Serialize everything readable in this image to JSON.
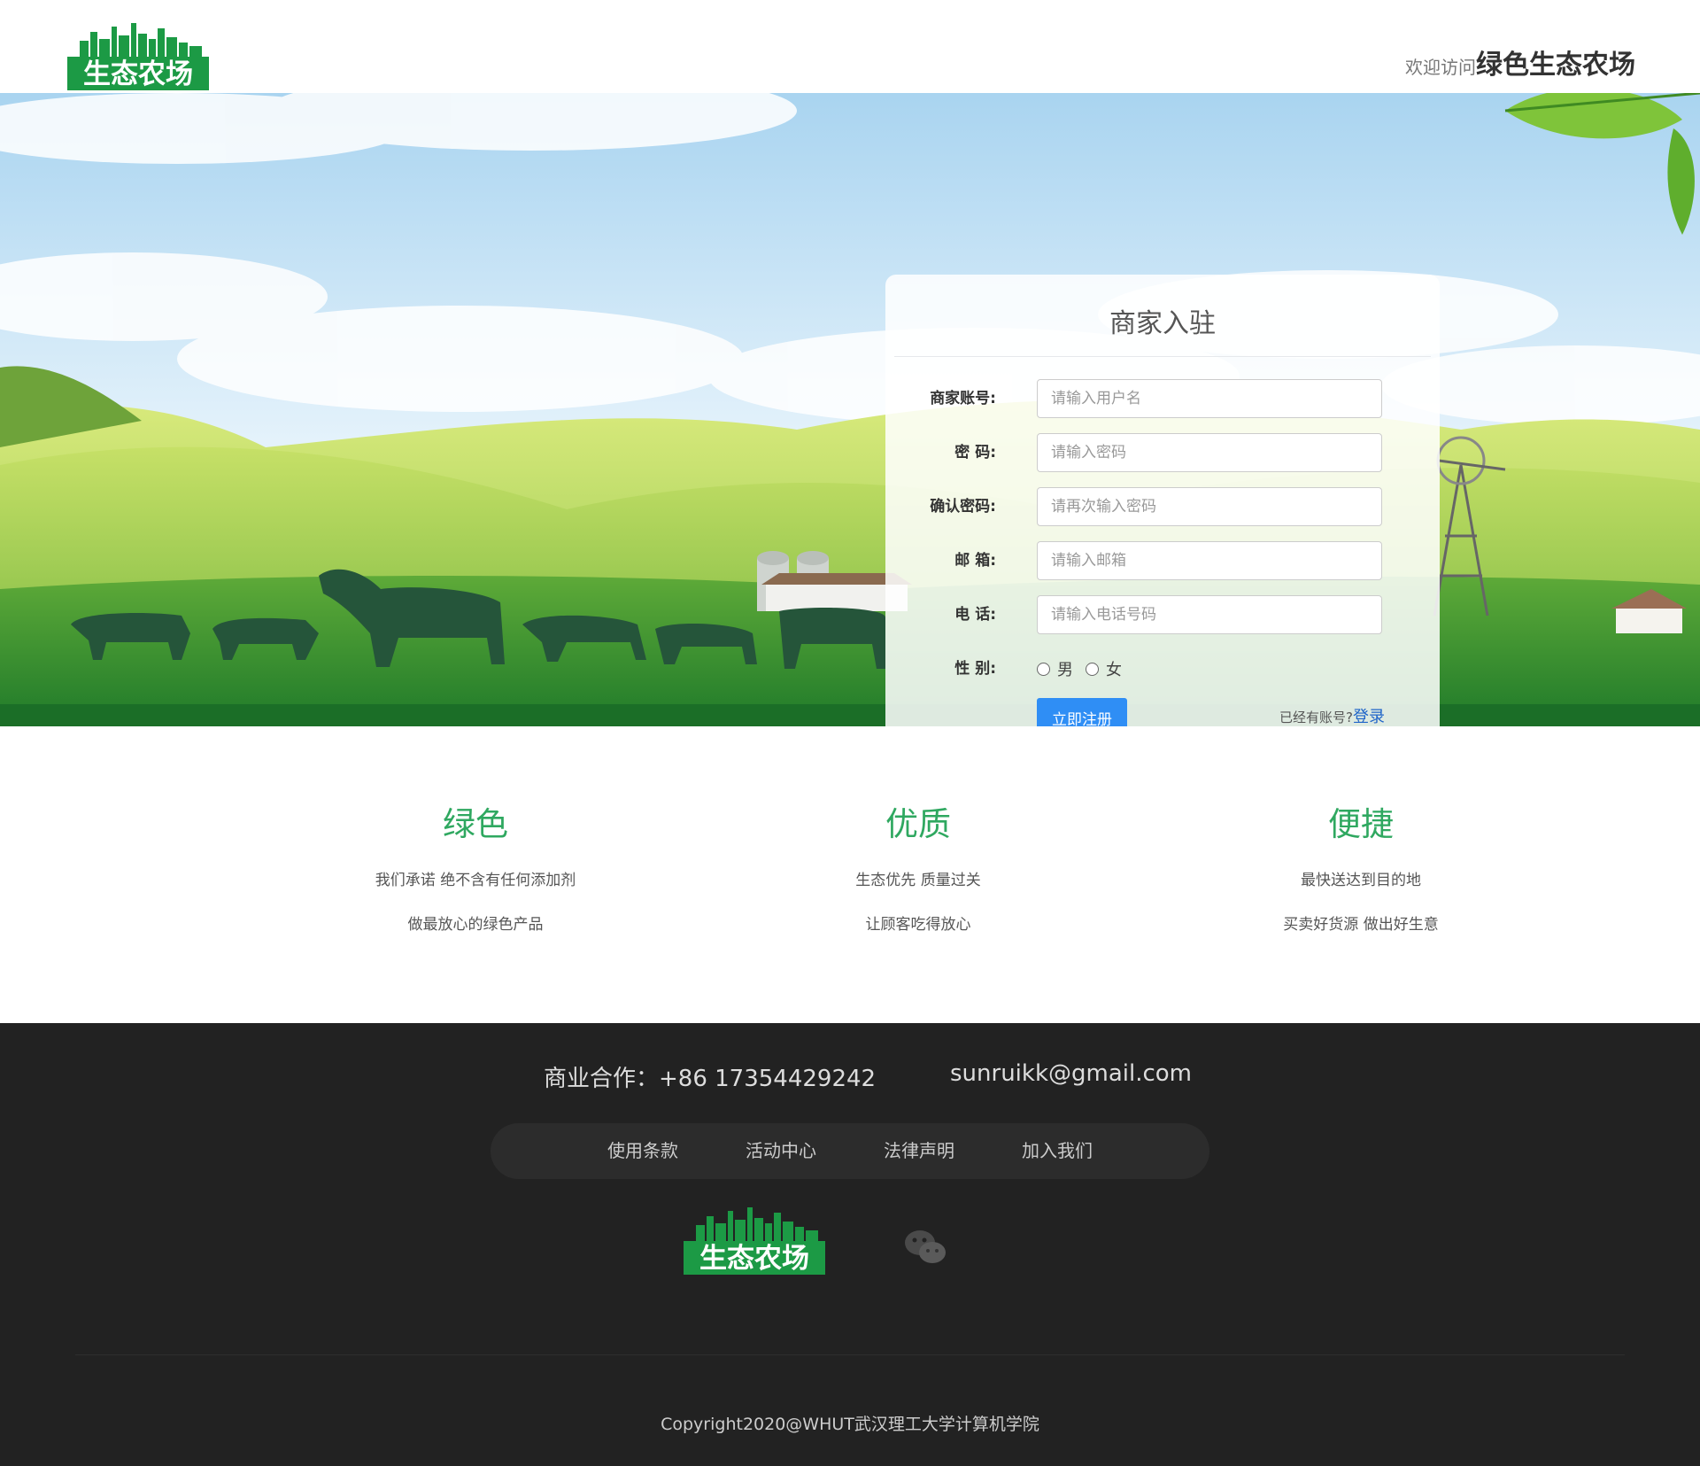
{
  "header": {
    "logo_text": "生态农场",
    "welcome_prefix": "欢迎访问",
    "welcome_name": "绿色生态农场"
  },
  "form": {
    "title": "商家入驻",
    "fields": [
      {
        "label": "商家账号:",
        "placeholder": "请输入用户名"
      },
      {
        "label": "密 码:",
        "placeholder": "请输入密码"
      },
      {
        "label": "确认密码:",
        "placeholder": "请再次输入密码"
      },
      {
        "label": "邮 箱:",
        "placeholder": "请输入邮箱"
      },
      {
        "label": "电 话:",
        "placeholder": "请输入电话号码"
      }
    ],
    "gender": {
      "label": "性 别:",
      "options": [
        "男",
        "女"
      ]
    },
    "submit_label": "立即注册",
    "have_account_text": "已经有账号?",
    "login_link": "登录"
  },
  "features": [
    {
      "title": "绿色",
      "lines": [
        "我们承诺 绝不含有任何添加剂",
        "做最放心的绿色产品"
      ]
    },
    {
      "title": "优质",
      "lines": [
        "生态优先 质量过关",
        "让顾客吃得放心"
      ]
    },
    {
      "title": "便捷",
      "lines": [
        "最快送达到目的地",
        "买卖好货源 做出好生意"
      ]
    }
  ],
  "footer": {
    "contact_tel": "商业合作：+86 17354429242",
    "contact_email": "sunruikk@gmail.com",
    "nav": [
      "使用条款",
      "活动中心",
      "法律声明",
      "加入我们"
    ],
    "logo_text": "生态农场",
    "copyright": "Copyright2020@WHUT武汉理工大学计算机学院"
  },
  "colors": {
    "brand_green": "#1c9a45",
    "feature_green": "#2fa860",
    "button_blue": "#2f8ef5",
    "footer_bg": "#222222"
  },
  "icons": [
    "logo-icon",
    "wechat-icon",
    "leaf-icon",
    "windmill-icon"
  ]
}
